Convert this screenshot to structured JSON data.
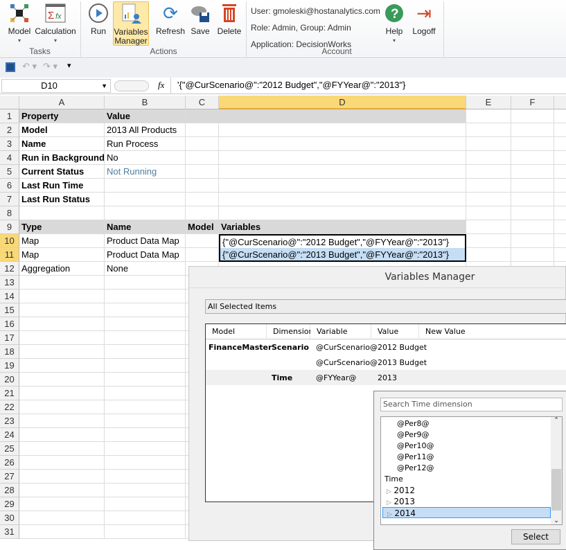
{
  "ribbon": {
    "tasks": {
      "label": "Tasks",
      "model": "Model",
      "calculation": "Calculation"
    },
    "actions": {
      "label": "Actions",
      "run": "Run",
      "variables_manager": "Variables Manager",
      "refresh": "Refresh",
      "save": "Save",
      "delete": "Delete"
    },
    "account": {
      "label": "Account",
      "user": "User: gmoleski@hostanalytics.com",
      "role": "Role: Admin, Group: Admin",
      "application": "Application: DecisionWorks",
      "help": "Help",
      "logoff": "Logoff"
    }
  },
  "formula_bar": {
    "name_box": "D10",
    "fx": "fx",
    "formula": "'{\"@CurScenario@\":\"2012 Budget\",\"@FYYear@\":\"2013\"}"
  },
  "columns": [
    "A",
    "B",
    "C",
    "D",
    "E",
    "F"
  ],
  "rows": [
    {
      "n": "1",
      "a": "Property",
      "b": "Value",
      "c": "",
      "d": ""
    },
    {
      "n": "2",
      "a": "Model",
      "b": "2013 All Products",
      "c": "",
      "d": ""
    },
    {
      "n": "3",
      "a": "Name",
      "b": "Run Process",
      "c": "",
      "d": ""
    },
    {
      "n": "4",
      "a": "Run in Background",
      "b": "No",
      "c": "",
      "d": ""
    },
    {
      "n": "5",
      "a": "Current Status",
      "b": "Not Running",
      "c": "",
      "d": ""
    },
    {
      "n": "6",
      "a": "Last Run Time",
      "b": "",
      "c": "",
      "d": ""
    },
    {
      "n": "7",
      "a": "Last Run Status",
      "b": "",
      "c": "",
      "d": ""
    },
    {
      "n": "8",
      "a": "",
      "b": "",
      "c": "",
      "d": ""
    },
    {
      "n": "9",
      "a": "Type",
      "b": "Name",
      "c": "Model",
      "d": "Variables"
    },
    {
      "n": "10",
      "a": "Map",
      "b": "Product Data Map",
      "c": "",
      "d": "{\"@CurScenario@\":\"2012 Budget\",\"@FYYear@\":\"2013\"}"
    },
    {
      "n": "11",
      "a": "Map",
      "b": "Product Data Map",
      "c": "",
      "d": "{\"@CurScenario@\":\"2013 Budget\",\"@FYYear@\":\"2013\"}"
    },
    {
      "n": "12",
      "a": "Aggregation",
      "b": "None",
      "c": "",
      "d": ""
    },
    {
      "n": "13"
    },
    {
      "n": "14"
    },
    {
      "n": "15"
    },
    {
      "n": "16"
    },
    {
      "n": "17"
    },
    {
      "n": "18"
    },
    {
      "n": "19"
    },
    {
      "n": "20"
    },
    {
      "n": "21"
    },
    {
      "n": "22"
    },
    {
      "n": "23"
    },
    {
      "n": "24"
    },
    {
      "n": "25"
    },
    {
      "n": "26"
    },
    {
      "n": "27"
    },
    {
      "n": "28"
    },
    {
      "n": "29"
    },
    {
      "n": "30"
    },
    {
      "n": "31"
    }
  ],
  "dialog": {
    "title": "Variables Manager",
    "filter": "All Selected Items",
    "headers": [
      "Model",
      "Dimension",
      "Variable",
      "Value",
      "New Value"
    ],
    "rows": [
      {
        "model": "FinanceMaster",
        "dimension": "Scenario",
        "variable": "@CurScenario@",
        "value": "2012 Budget"
      },
      {
        "model": "",
        "dimension": "",
        "variable": "@CurScenario@",
        "value": "2013 Budget"
      },
      {
        "model": "",
        "dimension": "Time",
        "variable": "@FYYear@",
        "value": "2013"
      }
    ],
    "picker": {
      "search_placeholder": "Search Time dimension",
      "items": [
        "@Per8@",
        "@Per9@",
        "@Per10@",
        "@Per11@",
        "@Per12@"
      ],
      "root": "Time",
      "years": [
        "2012",
        "2013",
        "2014"
      ],
      "selected": "2014",
      "select_button": "Select"
    }
  },
  "colors": {
    "selected_header": "#f9d877",
    "selection": "#c5def5",
    "accent": "#3399ff"
  }
}
